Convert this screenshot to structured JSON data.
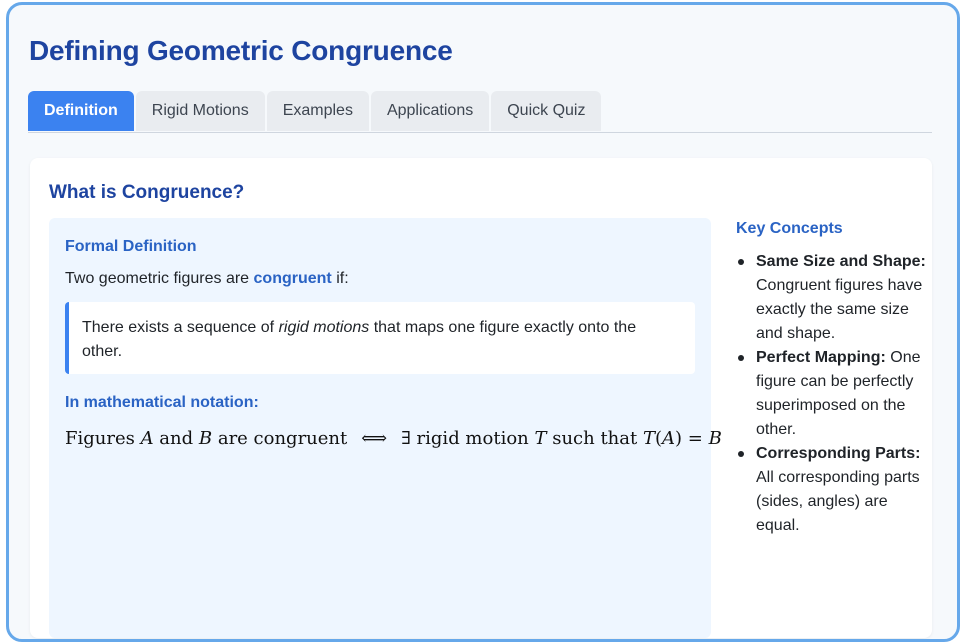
{
  "page": {
    "title": "Defining Geometric Congruence"
  },
  "tabs": [
    {
      "label": "Definition",
      "active": true
    },
    {
      "label": "Rigid Motions",
      "active": false
    },
    {
      "label": "Examples",
      "active": false
    },
    {
      "label": "Applications",
      "active": false
    },
    {
      "label": "Quick Quiz",
      "active": false
    }
  ],
  "section": {
    "title": "What is Congruence?",
    "formal_heading": "Formal Definition",
    "intro_before": "Two geometric figures are ",
    "intro_keyword": "congruent",
    "intro_after": " if:",
    "quote_before": "There exists a sequence of ",
    "quote_em": "rigid motions",
    "quote_after": " that maps one figure exactly onto the other.",
    "notation_label": "In mathematical notation:",
    "formula": {
      "t1": "Figures ",
      "a": "A",
      "t2": " and ",
      "b": "B",
      "t3": " are congruent",
      "iff": "⟺",
      "exists": "∃",
      "t4": " rigid motion ",
      "t": "T",
      "t5": " such that ",
      "lhs_t": "T",
      "lhs_open": "(",
      "lhs_a": "A",
      "lhs_close": ")",
      "eq": " = ",
      "rhs_b": "B"
    }
  },
  "key_concepts": {
    "title": "Key Concepts",
    "items": [
      {
        "term": "Same Size and Shape:",
        "desc": " Congruent figures have exactly the same size and shape."
      },
      {
        "term": "Perfect Mapping:",
        "desc": " One figure can be perfectly superimposed on the other."
      },
      {
        "term": "Corresponding Parts:",
        "desc": " All corresponding parts (sides, angles) are equal."
      }
    ]
  },
  "colors": {
    "accent": "#3b82f0",
    "title": "#1e44a0",
    "heading": "#2a63c4",
    "border": "#66a8ea",
    "box_bg": "#eef6ff"
  }
}
